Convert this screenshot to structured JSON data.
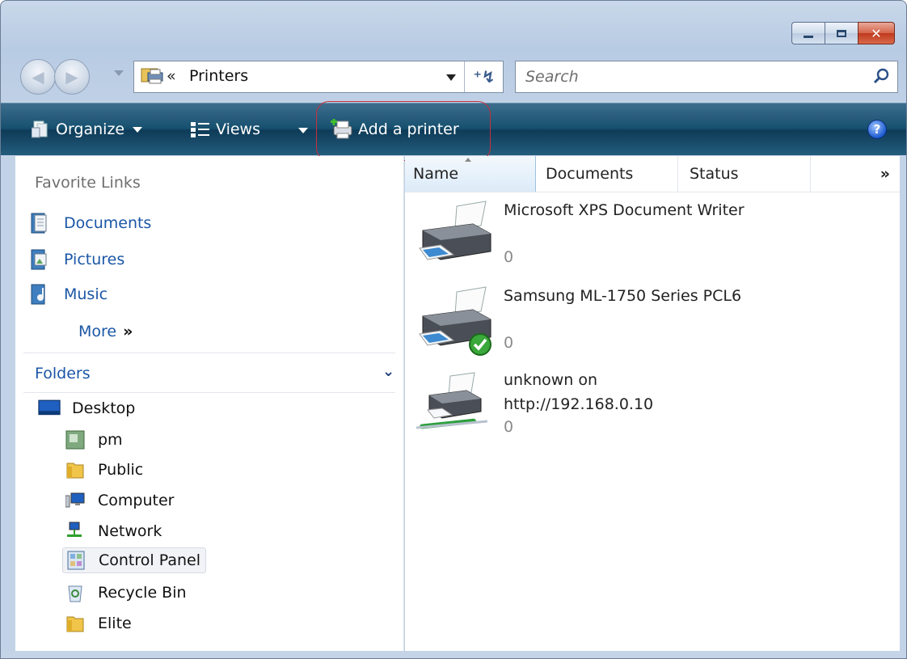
{
  "window": {
    "controls": {
      "minimize": "minimize-icon",
      "maximize": "maximize-icon",
      "close": "✕"
    }
  },
  "nav": {
    "back_icon": "back-arrow-icon",
    "forward_icon": "forward-arrow-icon",
    "address": {
      "separator": "«",
      "location": "Printers"
    },
    "refresh_symbol": "⁺↯",
    "search": {
      "placeholder": "Search"
    }
  },
  "toolbar": {
    "organize": "Organize",
    "views": "Views",
    "add_printer": "Add a printer",
    "help": "?"
  },
  "sidebar": {
    "favorite_links_title": "Favorite Links",
    "favorites": [
      {
        "label": "Documents",
        "icon": "documents-icon"
      },
      {
        "label": "Pictures",
        "icon": "pictures-icon"
      },
      {
        "label": "Music",
        "icon": "music-icon"
      }
    ],
    "more": "More",
    "more_symbol": "»",
    "folders_title": "Folders",
    "folders_chevron": "⌄",
    "tree": [
      {
        "label": "Desktop",
        "icon": "desktop-icon"
      },
      {
        "label": "pm",
        "icon": "user-folder-icon"
      },
      {
        "label": "Public",
        "icon": "folder-icon"
      },
      {
        "label": "Computer",
        "icon": "computer-icon"
      },
      {
        "label": "Network",
        "icon": "network-icon"
      },
      {
        "label": "Control Panel",
        "icon": "control-panel-icon"
      },
      {
        "label": "Recycle Bin",
        "icon": "recycle-bin-icon"
      },
      {
        "label": "Elite",
        "icon": "folder-icon"
      }
    ]
  },
  "content": {
    "columns": [
      "Name",
      "Documents",
      "Status",
      "»"
    ],
    "printers": [
      {
        "name": "Microsoft XPS Document Writer",
        "documents": "0",
        "default": false,
        "network": false
      },
      {
        "name": "Samsung ML-1750 Series PCL6",
        "documents": "0",
        "default": true,
        "network": false
      },
      {
        "name": "unknown on http://192.168.0.10",
        "documents": "0",
        "default": false,
        "network": true
      }
    ]
  },
  "colors": {
    "toolbar_bg": "#17506f",
    "link_blue": "#1b56a6",
    "highlight_ring": "#c8303a",
    "close_red": "#c0391d"
  }
}
